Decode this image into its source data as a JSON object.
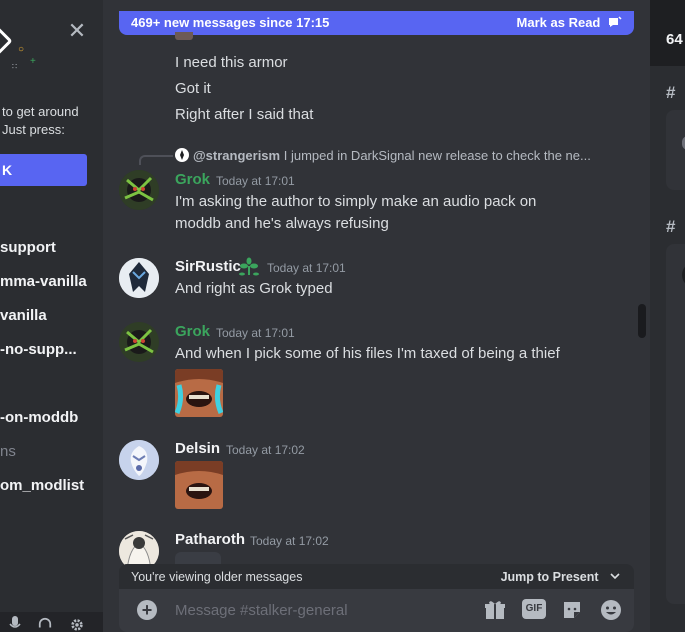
{
  "sidebar": {
    "popup": {
      "line1": "to get around",
      "line2": "Just press:",
      "button_label": "K"
    },
    "channels": [
      {
        "label": "support"
      },
      {
        "label": "mma-vanilla"
      },
      {
        "label": "vanilla"
      },
      {
        "label": "-no-supp..."
      },
      {
        "label": "-on-moddb"
      },
      {
        "label": "ns"
      },
      {
        "label": "om_modlist"
      }
    ]
  },
  "chat": {
    "new_messages_banner": "469+ new messages since 17:15",
    "mark_as_read": "Mark as Read",
    "top_messages": [
      "I need this armor",
      "Got it",
      "Right after I said that"
    ],
    "reply": {
      "author": "@strangerism",
      "snippet": "I jumped in DarkSignal new release to check the ne..."
    },
    "messages": [
      {
        "user": "Grok",
        "color": "#3ba55d",
        "time": "Today at 17:01",
        "lines": [
          "I'm asking the author to simply make an audio pack on",
          "moddb and he's always refusing"
        ]
      },
      {
        "user": "SirRustic",
        "color": "#f2f3f5",
        "time": "Today at 17:01",
        "lines": [
          "And right as Grok typed"
        ]
      },
      {
        "user": "Grok",
        "color": "#3ba55d",
        "time": "Today at 17:01",
        "lines": [
          "And when I pick some of his files I'm taxed of being a thief"
        ]
      },
      {
        "user": "Delsin",
        "color": "#f2f3f5",
        "time": "Today at 17:02",
        "lines": []
      },
      {
        "user": "Patharoth",
        "color": "#f2f3f5",
        "time": "Today at 17:02",
        "lines": []
      }
    ],
    "older_notice": "You're viewing older messages",
    "jump_to_present": "Jump to Present",
    "composer_placeholder": "Message #stalker-general",
    "gif_label": "GIF"
  },
  "right_panel": {
    "count": "64"
  }
}
